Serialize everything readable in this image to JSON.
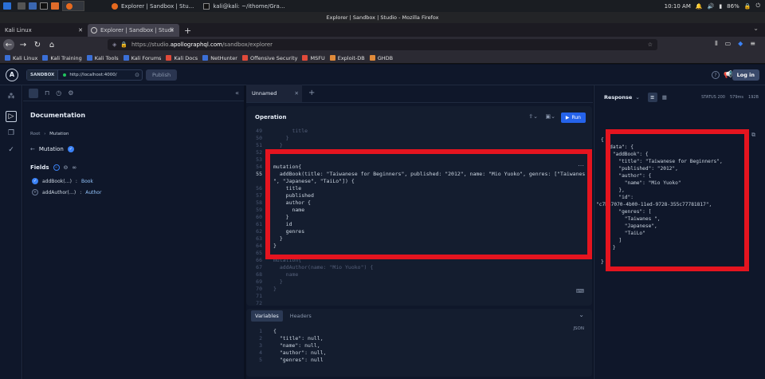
{
  "os": {
    "tasks": [
      {
        "label": ""
      },
      {
        "label": "Explorer | Sandbox | Stu..."
      },
      {
        "label": "kali@kali: ~/ithome/Gra..."
      }
    ],
    "time": "10:10 AM",
    "battery": "86%"
  },
  "firefox": {
    "window_title": "Explorer | Sandbox | Studio - Mozilla Firefox",
    "tabs": [
      {
        "label": "Kali Linux"
      },
      {
        "label": "Explorer | Sandbox | Studi"
      }
    ],
    "url_prefix": "https://studio.",
    "url_domain": "apollographql.com",
    "url_suffix": "/sandbox/explorer",
    "bookmarks": [
      {
        "label": "Kali Linux",
        "color": "#3b6fd6"
      },
      {
        "label": "Kali Training",
        "color": "#3b6fd6"
      },
      {
        "label": "Kali Tools",
        "color": "#3b6fd6"
      },
      {
        "label": "Kali Forums",
        "color": "#3b6fd6"
      },
      {
        "label": "Kali Docs",
        "color": "#e04a3a"
      },
      {
        "label": "NetHunter",
        "color": "#3b6fd6"
      },
      {
        "label": "Offensive Security",
        "color": "#e04a3a"
      },
      {
        "label": "MSFU",
        "color": "#e04a3a"
      },
      {
        "label": "Exploit-DB",
        "color": "#e08a3a"
      },
      {
        "label": "GHDB",
        "color": "#e08a3a"
      }
    ]
  },
  "app": {
    "logo": "A",
    "sandbox_label": "SANDBOX",
    "endpoint": "http://localhost:4000/",
    "publish": "Publish",
    "login": "Log in"
  },
  "docs": {
    "title": "Documentation",
    "crumb_root": "Root",
    "crumb_sep": "›",
    "crumb_current": "Mutation",
    "type_name": "Mutation",
    "fields_label": "Fields",
    "fields": [
      {
        "name": "addBook(…)",
        "sep": ":",
        "type": "Book"
      },
      {
        "name": "addAuthor(…)",
        "sep": ":",
        "type": "Author"
      }
    ]
  },
  "operation": {
    "tab_label": "Unnamed",
    "title": "Operation",
    "run": "Run",
    "lines": [
      {
        "n": "49",
        "text": "      title",
        "cls": "dim"
      },
      {
        "n": "50",
        "text": "    }",
        "cls": "dim"
      },
      {
        "n": "51",
        "text": "  }",
        "cls": "dim"
      },
      {
        "n": "52",
        "text": "",
        "cls": ""
      },
      {
        "n": "53",
        "text": "",
        "cls": ""
      },
      {
        "n": "54",
        "text": "mutation{",
        "cls": "kw"
      },
      {
        "n": "55",
        "text": "  addBook(title: \"Taiwanese for Beginners\", published: \"2012\", name: \"Mio Yuoko\", genres: [\"Taiwanes",
        "cls": "kw"
      },
      {
        "n": "",
        "text": "\", \"Japanese\", \"TaiLo\"]) {",
        "cls": "kw"
      },
      {
        "n": "56",
        "text": "    title",
        "cls": "kw"
      },
      {
        "n": "57",
        "text": "    published",
        "cls": "kw"
      },
      {
        "n": "58",
        "text": "    author {",
        "cls": "kw"
      },
      {
        "n": "59",
        "text": "      name",
        "cls": "kw"
      },
      {
        "n": "60",
        "text": "    }",
        "cls": "kw"
      },
      {
        "n": "61",
        "text": "    id",
        "cls": "kw"
      },
      {
        "n": "62",
        "text": "    genres",
        "cls": "kw"
      },
      {
        "n": "63",
        "text": "  }",
        "cls": "kw"
      },
      {
        "n": "64",
        "text": "}",
        "cls": "kw"
      },
      {
        "n": "65",
        "text": "",
        "cls": ""
      },
      {
        "n": "66",
        "text": "mutation{",
        "cls": "dim"
      },
      {
        "n": "67",
        "text": "  addAuthor(name: \"Mio Yuoko\") {",
        "cls": "dim"
      },
      {
        "n": "68",
        "text": "    name",
        "cls": "dim"
      },
      {
        "n": "69",
        "text": "  }",
        "cls": "dim"
      },
      {
        "n": "70",
        "text": "}",
        "cls": "dim"
      },
      {
        "n": "71",
        "text": "",
        "cls": ""
      },
      {
        "n": "72",
        "text": "",
        "cls": ""
      }
    ]
  },
  "variables": {
    "tab_variables": "Variables",
    "tab_headers": "Headers",
    "format": "JSON",
    "lines": [
      {
        "n": "1",
        "text": "{"
      },
      {
        "n": "2",
        "text": "  \"title\": null,"
      },
      {
        "n": "3",
        "text": "  \"name\": null,"
      },
      {
        "n": "4",
        "text": "  \"author\": null,"
      },
      {
        "n": "5",
        "text": "  \"genres\": null"
      }
    ]
  },
  "response": {
    "title": "Response",
    "status_label": "STATUS",
    "status": "200",
    "time": "579ms",
    "size": "192B",
    "lines": [
      "{",
      "  \"data\": {",
      "    \"addBook\": {",
      "      \"title\": \"Taiwanese for Beginners\",",
      "      \"published\": \"2012\",",
      "      \"author\": {",
      "        \"name\": \"Mio Yuoko\"",
      "      },",
      "      \"id\":",
      "\"c7b87070-4b00-11ed-9728-355c77781817\",",
      "      \"genres\": [",
      "        \"Taiwanes \",",
      "        \"Japanese\",",
      "        \"TaiLo\"",
      "      ]",
      "    }",
      "  }",
      "}"
    ]
  }
}
